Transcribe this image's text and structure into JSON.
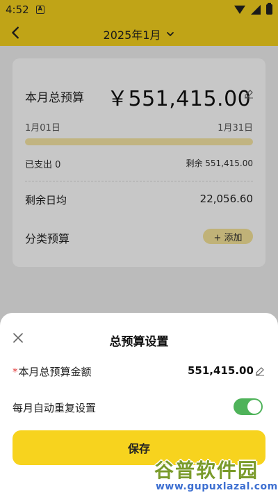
{
  "status": {
    "time": "4:52",
    "small_icon": "A"
  },
  "header": {
    "month": "2025年1月"
  },
  "budget": {
    "label": "本月总预算",
    "value": "￥551,415.00",
    "start_date": "1月01日",
    "end_date": "1月31日",
    "progress_percent": 0,
    "spent": "已支出 0",
    "remaining": "剩余 551,415.00",
    "daily_label": "剩余日均",
    "daily_value": "22,056.60",
    "category_label": "分类预算",
    "add_label": "+ 添加"
  },
  "sheet": {
    "title": "总预算设置",
    "required_mark": "*",
    "amount_label": "本月总预算金额",
    "amount_value": "551,415.00",
    "repeat_label": "每月自动重复设置",
    "repeat_enabled": true,
    "save_label": "保存"
  },
  "watermark": {
    "main": "谷普软件园",
    "url": "www.gupuxlazal.com"
  },
  "colors": {
    "accent": "#f7d31e",
    "toggle_on": "#4fb35a"
  }
}
